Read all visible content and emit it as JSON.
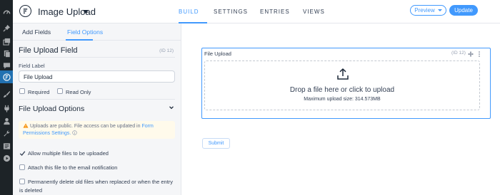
{
  "app": {
    "form_title": "Image Upload"
  },
  "nav": {
    "tabs": [
      "BUILD",
      "SETTINGS",
      "ENTRIES",
      "VIEWS"
    ],
    "active": "BUILD"
  },
  "actions": {
    "preview_label": "Preview",
    "update_label": "Update"
  },
  "sidebar": {
    "tabs": [
      "Add Fields",
      "Field Options"
    ],
    "active_tab": "Field Options",
    "field_title": "File Upload Field",
    "field_id": "(ID 12)",
    "field_label_caption": "Field Label",
    "field_label_value": "File Upload",
    "required_label": "Required",
    "readonly_label": "Read Only",
    "required_checked": false,
    "readonly_checked": false,
    "options_heading": "File Upload Options",
    "notice_text": "Uploads are public. File access can be updated in",
    "notice_link": "Form Permissions Settings.",
    "options": [
      {
        "label": "Allow multiple files to be uploaded",
        "checked": true
      },
      {
        "label": "Attach this file to the email notification",
        "checked": false
      },
      {
        "label": "Permanently delete old files when replaced or when the entry",
        "label_line2": "is deleted",
        "checked": false
      }
    ]
  },
  "canvas": {
    "field_label": "File Upload",
    "field_id": "(ID 12)",
    "drop_text": "Drop a file here or click to upload",
    "max_size_text": "Maximum upload size: 314.573MB",
    "submit_label": "Submit"
  },
  "colors": {
    "accent": "#4199fd",
    "admin_bar": "#1d2327",
    "admin_active": "#2271b1",
    "notice_bg": "#fffaeb"
  },
  "icons": {
    "admin_menu": [
      "dashboard-icon",
      "pin-icon",
      "media-icon",
      "pages-icon",
      "comments-icon",
      "formidable-icon",
      "appearance-icon",
      "plugins-icon",
      "users-icon",
      "tools-icon",
      "settings-icon",
      "play-icon"
    ]
  }
}
